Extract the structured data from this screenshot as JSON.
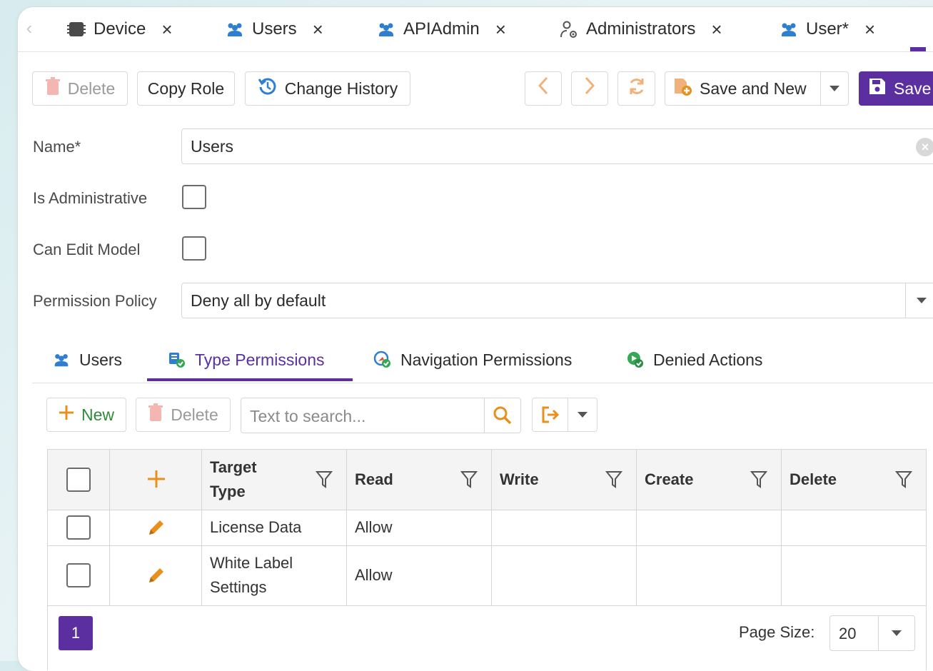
{
  "doc_tabs": [
    {
      "label": "Device",
      "icon": "device-icon"
    },
    {
      "label": "Users",
      "icon": "users-icon"
    },
    {
      "label": "APIAdmin",
      "icon": "users-icon"
    },
    {
      "label": "Administrators",
      "icon": "admin-user-icon"
    },
    {
      "label": "User*",
      "icon": "users-icon"
    }
  ],
  "doc_tab_close": "×",
  "toolbar": {
    "delete_label": "Delete",
    "copy_role_label": "Copy Role",
    "change_history_label": "Change History",
    "save_and_new_label": "Save and New",
    "save_label": "Save"
  },
  "form": {
    "name_label": "Name*",
    "name_value": "Users",
    "is_admin_label": "Is Administrative",
    "is_admin_checked": false,
    "can_edit_model_label": "Can Edit Model",
    "can_edit_model_checked": false,
    "permission_policy_label": "Permission Policy",
    "permission_policy_value": "Deny all by default"
  },
  "detail_tabs": [
    {
      "label": "Users",
      "icon": "users-icon",
      "active": false
    },
    {
      "label": "Type Permissions",
      "icon": "type-permissions-icon",
      "active": true
    },
    {
      "label": "Navigation Permissions",
      "icon": "navigation-permissions-icon",
      "active": false
    },
    {
      "label": "Denied Actions",
      "icon": "denied-actions-icon",
      "active": false
    }
  ],
  "grid_toolbar": {
    "new_label": "New",
    "delete_label": "Delete",
    "search_placeholder": "Text to search..."
  },
  "grid": {
    "new_row_symbol": "+",
    "columns": [
      {
        "label_line1": "Target",
        "label_line2": "Type"
      },
      {
        "label_line1": "Read"
      },
      {
        "label_line1": "Write"
      },
      {
        "label_line1": "Create"
      },
      {
        "label_line1": "Delete"
      }
    ],
    "rows": [
      {
        "target_line1": "License Data",
        "target_line2": "",
        "read": "Allow",
        "write": "",
        "create": "",
        "delete": ""
      },
      {
        "target_line1": "White Label",
        "target_line2": "Settings",
        "read": "Allow",
        "write": "",
        "create": "",
        "delete": ""
      }
    ]
  },
  "pager": {
    "current_page": "1",
    "page_size_label": "Page Size:",
    "page_size_value": "20"
  },
  "colors": {
    "accent": "#5b2fa0",
    "orange": "#e8901e",
    "blue_icon": "#2f7fd0",
    "green_icon": "#34a853"
  }
}
